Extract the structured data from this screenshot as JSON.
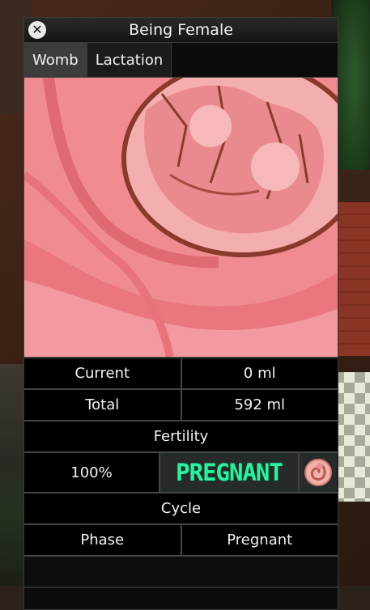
{
  "window": {
    "title": "Being Female",
    "close_icon": "close-icon"
  },
  "tabs": [
    {
      "label": "Womb",
      "active": true
    },
    {
      "label": "Lactation",
      "active": false
    }
  ],
  "womb_image": {
    "icon": "womb-pregnant-illustration"
  },
  "stats": {
    "current_label": "Current",
    "current_value": "0 ml",
    "total_label": "Total",
    "total_value": "592 ml"
  },
  "fertility": {
    "header": "Fertility",
    "value": "100%",
    "status": "PREGNANT",
    "status_icon": "fetus-icon",
    "status_color": "#2ff0a0"
  },
  "cycle": {
    "header": "Cycle",
    "phase_label": "Phase",
    "phase_value": "Pregnant"
  }
}
